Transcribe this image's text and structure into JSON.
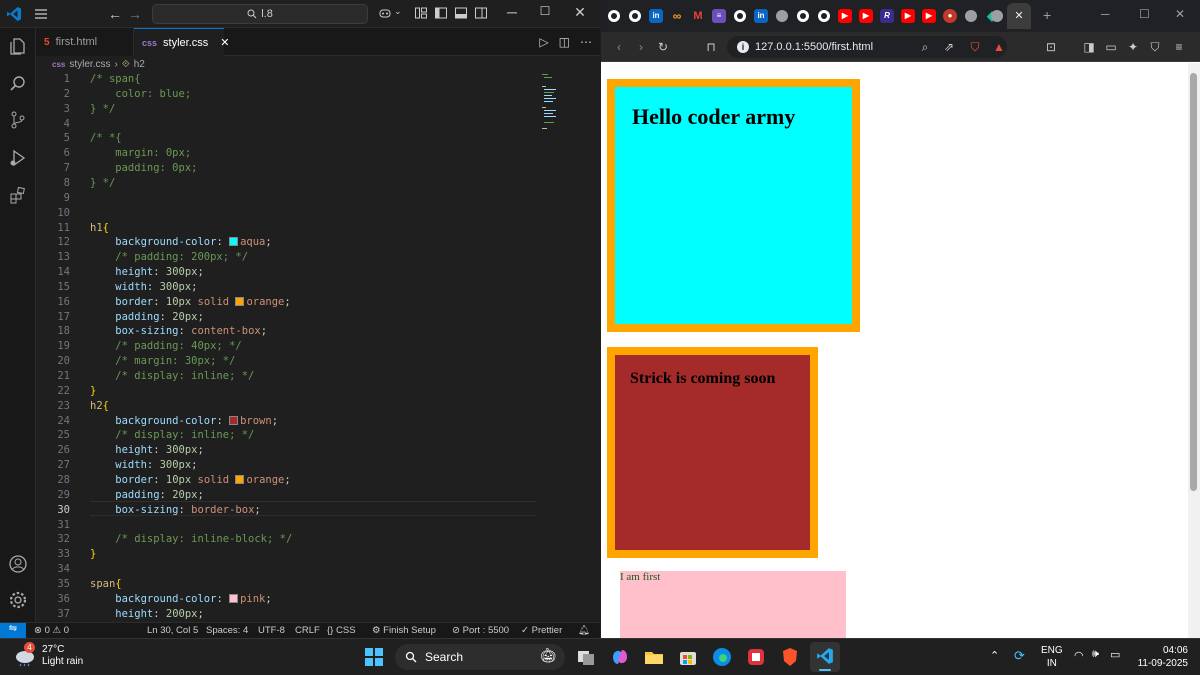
{
  "vscode": {
    "search_text": "l.8",
    "tabs": [
      {
        "label": "first.html",
        "icon": "html5-icon",
        "active": false
      },
      {
        "label": "styler.css",
        "icon": "css-icon",
        "active": true
      }
    ],
    "breadcrumb": {
      "file": "styler.css",
      "symbol": "h2"
    },
    "lines": [
      {
        "n": "1",
        "segs": [
          [
            "cm",
            "/* span{"
          ]
        ]
      },
      {
        "n": "2",
        "segs": [
          [
            "cm",
            "    color: blue;"
          ]
        ]
      },
      {
        "n": "3",
        "segs": [
          [
            "cm",
            "} */"
          ]
        ]
      },
      {
        "n": "4",
        "segs": []
      },
      {
        "n": "5",
        "segs": [
          [
            "cm",
            "/* *{"
          ]
        ]
      },
      {
        "n": "6",
        "segs": [
          [
            "cm",
            "    margin: 0px;"
          ]
        ]
      },
      {
        "n": "7",
        "segs": [
          [
            "cm",
            "    padding: 0px;"
          ]
        ]
      },
      {
        "n": "8",
        "segs": [
          [
            "cm",
            "} */"
          ]
        ]
      },
      {
        "n": "9",
        "segs": []
      },
      {
        "n": "10",
        "segs": []
      },
      {
        "n": "11",
        "segs": [
          [
            "sel",
            "h1"
          ],
          [
            "brk2",
            "{"
          ]
        ]
      },
      {
        "n": "12",
        "segs": [
          [
            "prop",
            "    background-color"
          ],
          [
            "pun",
            ": "
          ],
          [
            "sw:#00ffff",
            ""
          ],
          [
            "val",
            "aqua"
          ],
          [
            "pun",
            ";"
          ]
        ]
      },
      {
        "n": "13",
        "segs": [
          [
            "cm",
            "    /* padding: 200px; */"
          ]
        ]
      },
      {
        "n": "14",
        "segs": [
          [
            "prop",
            "    height"
          ],
          [
            "pun",
            ": "
          ],
          [
            "num",
            "300px"
          ],
          [
            "pun",
            ";"
          ]
        ]
      },
      {
        "n": "15",
        "segs": [
          [
            "prop",
            "    width"
          ],
          [
            "pun",
            ": "
          ],
          [
            "num",
            "300px"
          ],
          [
            "pun",
            ";"
          ]
        ]
      },
      {
        "n": "16",
        "segs": [
          [
            "prop",
            "    border"
          ],
          [
            "pun",
            ": "
          ],
          [
            "num",
            "10px"
          ],
          [
            "val",
            " solid "
          ],
          [
            "sw:#ffa500",
            ""
          ],
          [
            "val",
            "orange"
          ],
          [
            "pun",
            ";"
          ]
        ]
      },
      {
        "n": "17",
        "segs": [
          [
            "prop",
            "    padding"
          ],
          [
            "pun",
            ": "
          ],
          [
            "num",
            "20px"
          ],
          [
            "pun",
            ";"
          ]
        ]
      },
      {
        "n": "18",
        "segs": [
          [
            "prop",
            "    box-sizing"
          ],
          [
            "pun",
            ": "
          ],
          [
            "val",
            "content-box"
          ],
          [
            "pun",
            ";"
          ]
        ]
      },
      {
        "n": "19",
        "segs": [
          [
            "cm",
            "    /* padding: 40px; */"
          ]
        ]
      },
      {
        "n": "20",
        "segs": [
          [
            "cm",
            "    /* margin: 30px; */"
          ]
        ]
      },
      {
        "n": "21",
        "segs": [
          [
            "cm",
            "    /* display: inline; */"
          ]
        ]
      },
      {
        "n": "22",
        "segs": [
          [
            "brk2",
            "}"
          ]
        ]
      },
      {
        "n": "23",
        "segs": [
          [
            "sel",
            "h2"
          ],
          [
            "brk2",
            "{"
          ]
        ]
      },
      {
        "n": "24",
        "segs": [
          [
            "prop",
            "    background-color"
          ],
          [
            "pun",
            ": "
          ],
          [
            "sw:#a52a2a",
            ""
          ],
          [
            "val",
            "brown"
          ],
          [
            "pun",
            ";"
          ]
        ]
      },
      {
        "n": "25",
        "segs": [
          [
            "cm",
            "    /* display: inline; */"
          ]
        ]
      },
      {
        "n": "26",
        "segs": [
          [
            "prop",
            "    height"
          ],
          [
            "pun",
            ": "
          ],
          [
            "num",
            "300px"
          ],
          [
            "pun",
            ";"
          ]
        ]
      },
      {
        "n": "27",
        "segs": [
          [
            "prop",
            "    width"
          ],
          [
            "pun",
            ": "
          ],
          [
            "num",
            "300px"
          ],
          [
            "pun",
            ";"
          ]
        ]
      },
      {
        "n": "28",
        "segs": [
          [
            "prop",
            "    border"
          ],
          [
            "pun",
            ": "
          ],
          [
            "num",
            "10px"
          ],
          [
            "val",
            " solid "
          ],
          [
            "sw:#ffa500",
            ""
          ],
          [
            "val",
            "orange"
          ],
          [
            "pun",
            ";"
          ]
        ]
      },
      {
        "n": "29",
        "segs": [
          [
            "prop",
            "    padding"
          ],
          [
            "pun",
            ": "
          ],
          [
            "num",
            "20px"
          ],
          [
            "pun",
            ";"
          ]
        ]
      },
      {
        "n": "30",
        "segs": [
          [
            "prop",
            "    box-sizing"
          ],
          [
            "pun",
            ": "
          ],
          [
            "val",
            "border-box"
          ],
          [
            "pun",
            ";"
          ]
        ]
      },
      {
        "n": "31",
        "segs": []
      },
      {
        "n": "32",
        "segs": [
          [
            "cm",
            "    /* display: inline-block; */"
          ]
        ]
      },
      {
        "n": "33",
        "segs": [
          [
            "brk2",
            "}"
          ]
        ]
      },
      {
        "n": "34",
        "segs": []
      },
      {
        "n": "35",
        "segs": [
          [
            "sel",
            "span"
          ],
          [
            "brk2",
            "{"
          ]
        ]
      },
      {
        "n": "36",
        "segs": [
          [
            "prop",
            "    background-color"
          ],
          [
            "pun",
            ": "
          ],
          [
            "sw:#ffc0cb",
            ""
          ],
          [
            "val",
            "pink"
          ],
          [
            "pun",
            ";"
          ]
        ]
      },
      {
        "n": "37",
        "segs": [
          [
            "prop",
            "    height"
          ],
          [
            "pun",
            ": "
          ],
          [
            "num",
            "200px"
          ],
          [
            "pun",
            ";"
          ]
        ]
      }
    ],
    "current_line": "30",
    "status": {
      "problems": "0",
      "warnings": "0",
      "position": "Ln 30, Col 5",
      "spaces": "Spaces: 4",
      "encoding": "UTF-8",
      "eol": "CRLF",
      "language": "CSS",
      "setup": "Finish Setup",
      "port": "Port : 5500",
      "prettier": "Prettier"
    }
  },
  "browser": {
    "url": "127.0.0.1:5500/first.html",
    "page": {
      "h1": "Hello coder army",
      "h2": "Strick is coming soon",
      "span": "I am first"
    },
    "colors": {
      "h1_bg": "#00ffff",
      "h2_bg": "#a52a2a",
      "border": "#ffa500",
      "span_bg": "#ffc0cb"
    }
  },
  "taskbar": {
    "weather_temp": "27°C",
    "weather_desc": "Light rain",
    "weather_badge": "4",
    "search_label": "Search",
    "lang": "ENG",
    "region": "IN",
    "time": "04:06",
    "date": "11-09-2025"
  }
}
